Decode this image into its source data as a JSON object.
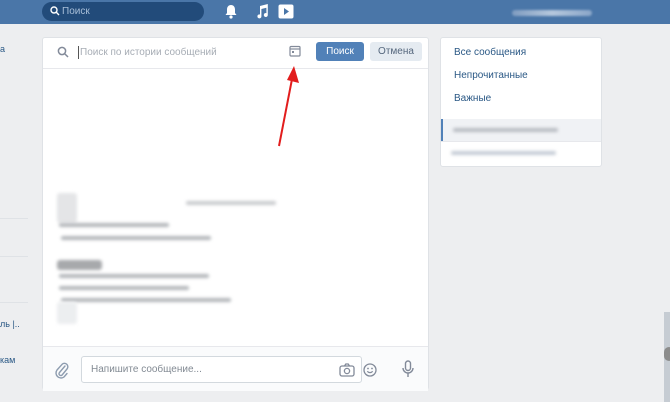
{
  "topbar": {
    "search_placeholder": "Поиск",
    "icons": [
      "search-icon",
      "bell-icon",
      "music-note-icon",
      "video-play-icon"
    ]
  },
  "left_nav_fragments": [
    "а",
    "ль |..",
    "кам"
  ],
  "chat": {
    "search": {
      "placeholder": "Поиск по истории сообщений",
      "search_button": "Поиск",
      "cancel_button": "Отмена"
    },
    "composer": {
      "placeholder": "Напишите сообщение..."
    }
  },
  "filters": {
    "items": [
      {
        "label": "Все сообщения"
      },
      {
        "label": "Непрочитанные"
      },
      {
        "label": "Важные"
      }
    ]
  },
  "colors": {
    "topbar": "#4a76a8",
    "accent": "#5181b8",
    "annotation_arrow": "#e21d1d"
  }
}
